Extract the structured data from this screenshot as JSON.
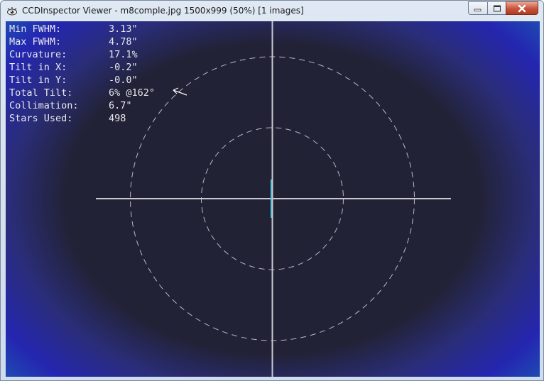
{
  "window": {
    "title": "CCDInspector Viewer - m8comple.jpg 1500x999 (50%)  [1 images]",
    "icons": {
      "app": "ccdinspector-eye-icon",
      "minimize": "minimize-icon",
      "maximize": "maximize-icon",
      "close": "close-icon"
    }
  },
  "stats": [
    {
      "label": "Min FWHM:",
      "value": "3.13\""
    },
    {
      "label": "Max FWHM:",
      "value": "4.78\""
    },
    {
      "label": "Curvature:",
      "value": "17.1%"
    },
    {
      "label": "Tilt in X:",
      "value": "-0.2\""
    },
    {
      "label": "Tilt in Y:",
      "value": "-0.0\""
    },
    {
      "label": "Total Tilt:",
      "value": "6% @162°"
    },
    {
      "label": "Collimation:",
      "value": "6.7\""
    },
    {
      "label": "Stars Used:",
      "value": "498"
    }
  ],
  "colors": {
    "center_background": "#222236",
    "edge_blue": "#2426b0",
    "corner_cyan": "#17a8b8",
    "crosshair": "#c8c8d0",
    "tilt_marker": "#5fc8d8",
    "close_button": "#c7523a"
  }
}
